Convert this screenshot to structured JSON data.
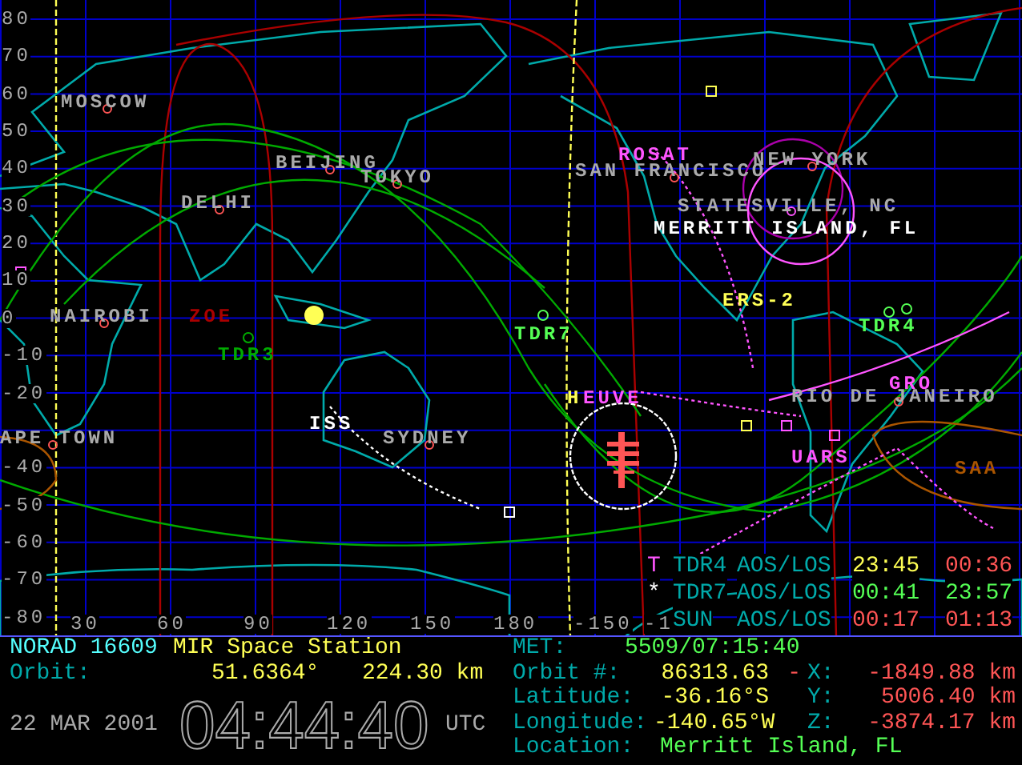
{
  "map": {
    "latitude_labels": [
      "80",
      "70",
      "60",
      "50",
      "40",
      "30",
      "20",
      "10",
      "0",
      "-10",
      "-20",
      "-40",
      "-50",
      "-60",
      "-70",
      "-80"
    ],
    "longitude_labels": [
      "30",
      "60",
      "90",
      "120",
      "150",
      "180",
      "-150",
      "-1"
    ],
    "cities": [
      {
        "label": "MOSCOW",
        "highlighted": false
      },
      {
        "label": "BEIJING",
        "highlighted": false
      },
      {
        "label": "TOKYO",
        "highlighted": false
      },
      {
        "label": "DELHI",
        "highlighted": false
      },
      {
        "label": "NAIROBI",
        "highlighted": false
      },
      {
        "label": "APE TOWN",
        "highlighted": false
      },
      {
        "label": "SYDNEY",
        "highlighted": false
      },
      {
        "label": "SAN FRANCISCO",
        "highlighted": false
      },
      {
        "label": "NEW YORK",
        "highlighted": false
      },
      {
        "label": "STATESVILLE, NC",
        "highlighted": false
      },
      {
        "label": "MERRITT ISLAND, FL",
        "highlighted": true
      },
      {
        "label": "RIO DE JANEIRO",
        "highlighted": false
      }
    ],
    "satellites": [
      {
        "label": "ZOE",
        "color": "#aa0000"
      },
      {
        "label": "TDR3",
        "color": "#00aa00"
      },
      {
        "label": "ISS",
        "color": "#ffffff"
      },
      {
        "label": "TDR7",
        "color": "#55ff55"
      },
      {
        "label": "ROSAT",
        "color": "#ff55ff"
      },
      {
        "label": "ERS-2",
        "color": "#ffff55"
      },
      {
        "label": "TDR4",
        "color": "#55ff55"
      },
      {
        "label": "H",
        "color": "#ffff55"
      },
      {
        "label": "EUVE",
        "color": "#ff55ff"
      },
      {
        "label": "GRO",
        "color": "#ff55ff"
      },
      {
        "label": "UARS",
        "color": "#ff55ff"
      },
      {
        "label": "SAA",
        "color": "#aa5500"
      }
    ],
    "tracking": [
      {
        "marker": {
          "text": "T",
          "color": "#ff55ff"
        },
        "station": "TDR4",
        "event": "AOS/LOS",
        "aos": {
          "text": "23:45",
          "color": "#ffff55"
        },
        "los": {
          "text": "00:36",
          "color": "#ff5555"
        }
      },
      {
        "marker": {
          "text": "*",
          "color": "#ffffff"
        },
        "station": "TDR7",
        "event": "AOS/LOS",
        "aos": {
          "text": "00:41",
          "color": "#55ff55"
        },
        "los": {
          "text": "23:57",
          "color": "#55ff55"
        }
      },
      {
        "station": "SUN",
        "event": "AOS/LOS",
        "aos": {
          "text": "00:17",
          "color": "#ff5555"
        },
        "los": {
          "text": "01:13",
          "color": "#ff5555"
        }
      }
    ]
  },
  "status": {
    "norad": "NORAD 16609",
    "name": "MIR Space Station",
    "orbit_label": "Orbit:",
    "inclination": "51.6364°",
    "altitude": "224.30 km",
    "date": "22 MAR 2001",
    "clock": "04:44:40",
    "timezone": "UTC",
    "met_label": "MET:",
    "met": "5509/07:15:40",
    "orbit_number_label": "Orbit #:",
    "orbit_number": "86313.63",
    "latitude_label": "Latitude:",
    "latitude": "-36.16°S",
    "longitude_label": "Longitude:",
    "longitude": "-140.65°W",
    "position": [
      {
        "dash": "-",
        "label": "X:",
        "value": "-1849.88 km"
      },
      {
        "label": "Y:",
        "value": "5006.40 km"
      },
      {
        "label": "Z:",
        "value": "-3874.17 km"
      }
    ],
    "location_label": "Location:",
    "location": "Merritt Island, FL"
  }
}
